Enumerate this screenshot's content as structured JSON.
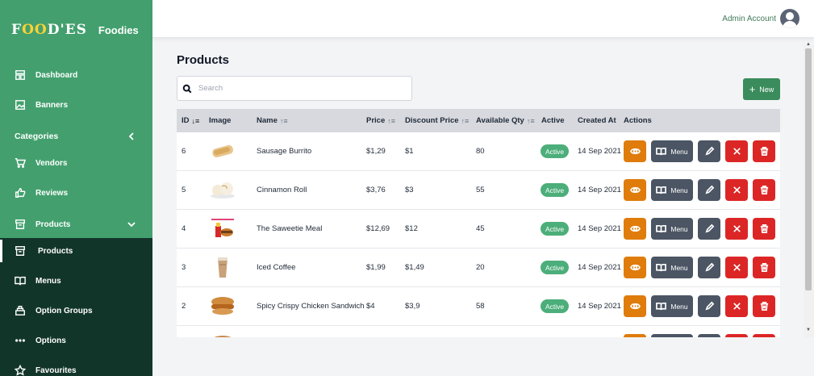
{
  "brand": {
    "logo_text": "FOODIES",
    "name": "Foodies"
  },
  "sidebar": {
    "items": [
      {
        "label": "Dashboard",
        "icon": "dashboard-icon"
      },
      {
        "label": "Banners",
        "icon": "image-icon"
      },
      {
        "label": "Categories",
        "icon": ""
      },
      {
        "label": "Vendors",
        "icon": "cart-icon"
      },
      {
        "label": "Reviews",
        "icon": "thumbs-up-icon"
      },
      {
        "label": "Products",
        "icon": "archive-icon"
      },
      {
        "label": "Products",
        "icon": "archive-icon"
      },
      {
        "label": "Menus",
        "icon": "book-icon"
      },
      {
        "label": "Option Groups",
        "icon": "layers-icon"
      },
      {
        "label": "Options",
        "icon": "dots-icon"
      },
      {
        "label": "Favourites",
        "icon": "star-icon"
      }
    ]
  },
  "header": {
    "account_label": "Admin Account"
  },
  "main": {
    "title": "Products",
    "search_placeholder": "Search",
    "new_label": "New"
  },
  "table": {
    "columns": [
      "ID",
      "Image",
      "Name",
      "Price",
      "Discount Price",
      "Available Qty",
      "Active",
      "Created At",
      "Actions"
    ],
    "rows": [
      {
        "id": "6",
        "name": "Sausage Burrito",
        "price": "$1,29",
        "discount": "$1",
        "qty": "80",
        "active": "Active",
        "created": "14 Sep 2021"
      },
      {
        "id": "5",
        "name": "Cinnamon Roll",
        "price": "$3,76",
        "discount": "$3",
        "qty": "55",
        "active": "Active",
        "created": "14 Sep 2021"
      },
      {
        "id": "4",
        "name": "The Saweetie Meal",
        "price": "$12,69",
        "discount": "$12",
        "qty": "45",
        "active": "Active",
        "created": "14 Sep 2021"
      },
      {
        "id": "3",
        "name": "Iced Coffee",
        "price": "$1,99",
        "discount": "$1,49",
        "qty": "20",
        "active": "Active",
        "created": "14 Sep 2021"
      },
      {
        "id": "2",
        "name": "Spicy Crispy Chicken Sandwich",
        "price": "$4",
        "discount": "$3,9",
        "qty": "58",
        "active": "Active",
        "created": "14 Sep 2021"
      },
      {
        "id": "",
        "name": "",
        "price": "",
        "discount": "",
        "qty": "",
        "active": "",
        "created": ""
      }
    ],
    "menu_label": "Menu"
  },
  "colors": {
    "sidebar_green": "#43a06e",
    "sidebar_dark": "#12352a",
    "primary_button": "#3a8c5c",
    "view_button": "#df7c0b",
    "danger_button": "#dc2626",
    "neutral_button": "#4b5563",
    "active_badge": "#4cae7a"
  }
}
